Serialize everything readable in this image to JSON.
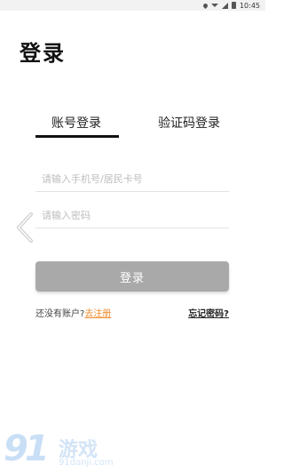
{
  "status_bar": {
    "time": "10:45",
    "icons": [
      "location-icon",
      "wifi-icon",
      "signal-icon",
      "battery-icon"
    ]
  },
  "page": {
    "title": "登录"
  },
  "tabs": [
    {
      "label": "账号登录",
      "active": true
    },
    {
      "label": "验证码登录",
      "active": false
    }
  ],
  "form": {
    "phone_placeholder": "请输入手机号/居民卡号",
    "password_placeholder": "请输入密码",
    "login_label": "登录"
  },
  "links": {
    "no_account_text": "还没有账户?",
    "register_label": "去注册",
    "forgot_label": "忘记密码?"
  },
  "watermark": {
    "number": "91",
    "brand": "游戏",
    "domain": "91danji.com"
  },
  "colors": {
    "button_bg": "#a9a9a9",
    "register_link": "#f08a2c",
    "tab_indicator": "#111111"
  }
}
